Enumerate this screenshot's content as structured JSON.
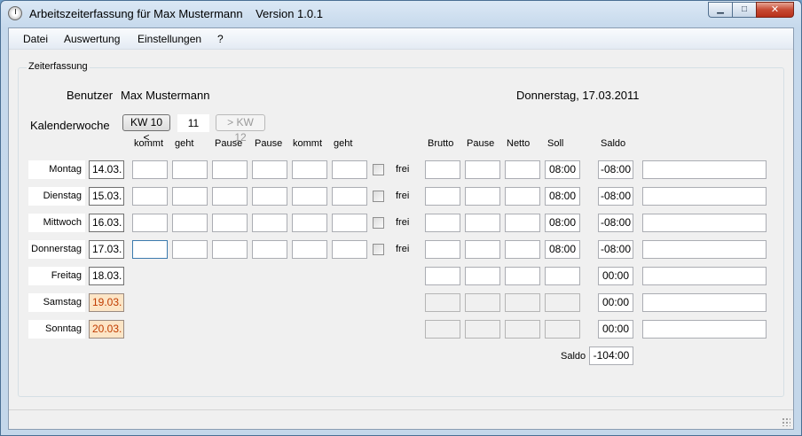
{
  "window": {
    "title": "Arbeitszeiterfassung für Max Mustermann",
    "version": "Version 1.0.1",
    "buttons": {
      "minimize": "▁",
      "maximize": "□",
      "close": "✕"
    }
  },
  "menu": [
    "Datei",
    "Auswertung",
    "Einstellungen",
    "?"
  ],
  "group": {
    "title": "Zeiterfassung",
    "user_label": "Benutzer",
    "user_name": "Max Mustermann",
    "date": "Donnerstag, 17.03.2011",
    "week_label": "Kalenderwoche",
    "prev_week_button": "KW 10 <",
    "current_week": "11",
    "next_week_button": "> KW 12"
  },
  "headers": {
    "kommt1": "kommt",
    "geht1": "geht",
    "pause1": "Pause",
    "pause2": "Pause",
    "kommt2": "kommt",
    "geht2": "geht",
    "brutto": "Brutto",
    "pause": "Pause",
    "netto": "Netto",
    "soll": "Soll",
    "saldo": "Saldo"
  },
  "days": [
    {
      "name": "Montag",
      "date": "14.03.",
      "frei": "frei",
      "soll": "08:00",
      "saldo": "-08:00"
    },
    {
      "name": "Dienstag",
      "date": "15.03.",
      "frei": "frei",
      "soll": "08:00",
      "saldo": "-08:00"
    },
    {
      "name": "Mittwoch",
      "date": "16.03.",
      "frei": "frei",
      "soll": "08:00",
      "saldo": "-08:00"
    },
    {
      "name": "Donnerstag",
      "date": "17.03.",
      "frei": "frei",
      "soll": "08:00",
      "saldo": "-08:00"
    },
    {
      "name": "Freitag",
      "date": "18.03.",
      "frei": "",
      "soll": "",
      "saldo": "00:00"
    },
    {
      "name": "Samstag",
      "date": "19.03.",
      "frei": "",
      "soll": "",
      "saldo": "00:00"
    },
    {
      "name": "Sonntag",
      "date": "20.03.",
      "frei": "",
      "soll": "",
      "saldo": "00:00"
    }
  ],
  "total": {
    "label": "Saldo",
    "value": "-104:00"
  },
  "colors": {
    "weekend_bg": "#fce5c6",
    "weekend_text": "#c03c00"
  }
}
